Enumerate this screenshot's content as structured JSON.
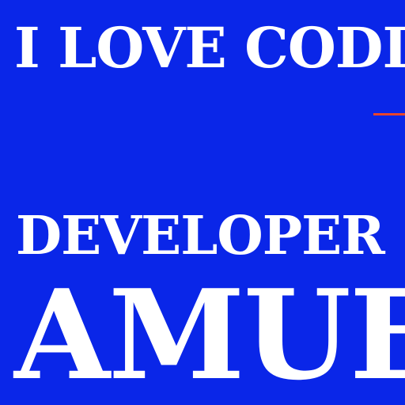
{
  "banner": {
    "line1": "I LOVE CODIN",
    "line2": "DEVELOPER",
    "line3": "AMUE"
  },
  "colors": {
    "background": "#0a26e8",
    "text": "#ffffff",
    "accent": "#e8452a"
  }
}
